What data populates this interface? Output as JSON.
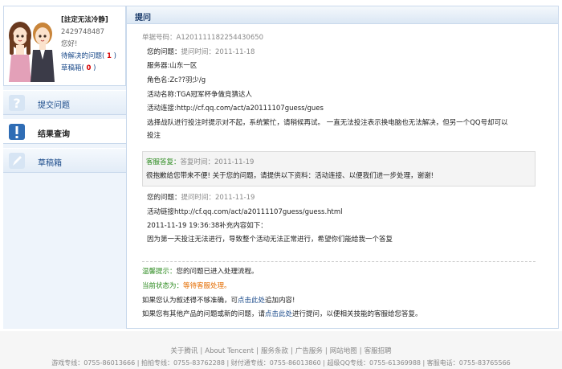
{
  "profile": {
    "username": "[註定无法冷静]",
    "qq": "2429748487",
    "greeting": "您好!",
    "pending_label": "待解决的问题(",
    "pending_count": "1",
    "drafts_label": "草稿箱(",
    "drafts_count": "0",
    "close_paren": ")"
  },
  "nav": [
    {
      "label": "提交问题"
    },
    {
      "label": "结果查询"
    },
    {
      "label": "草稿箱"
    }
  ],
  "panel": {
    "title": "提问",
    "ticket": "单据号码：A120111118225443065​0"
  },
  "question1": {
    "title": "您的问题：",
    "time": "提问时间：2011-11-18",
    "server": "服务器:山东一区",
    "role": "角色名:Zc??羽少/g",
    "activity": "活动名称:TGA冠军杯争做竞猜达人",
    "link": "活动连接:http://cf.qq.com/act/a20111107guess/gues",
    "desc1": "选择战队进行投注时提示对不起，系统繁忙，请稍候再试。  一直无法投注表示换电脑也无法解决，但另一个QQ号却可以",
    "desc2": "投注"
  },
  "reply": {
    "label": "客服答复：",
    "time": "答复时间：2011-11-19",
    "text": "很抱歉给您带来不便! 关于您的问题，请提供以下资料：活动连接、以便我们进一步处理，谢谢!"
  },
  "question2": {
    "title": "您的问题：",
    "time": "提问时间：2011-11-19",
    "link": "活动链接http://cf.qq.com/act/a20111107guess/guess.html",
    "supplement": "2011-11-19 19:36:38补充内容如下：",
    "desc": "因为第一天投注无法进行，导致整个活动无法正常进行，希望你们能给我一个答复"
  },
  "status": {
    "tip_label": "温馨提示：",
    "tip_text": "您的问题已进入处理流程。",
    "state_label": "当前状态为：",
    "state_value": "等待客服处理。",
    "line3_pre": "如果您认为叙述得不够准确，可",
    "line3_link": "点击此处",
    "line3_post": "追加内容!",
    "line4_pre": "如果您有其他产品的问题或新的问题，请",
    "line4_link": "点击此处",
    "line4_post": "进行提问，以便相关技能的客服给您答复。"
  },
  "footer": {
    "links": [
      "关于腾讯",
      "About Tencent",
      "服务条款",
      "广告服务",
      "网站地图",
      "客服招聘"
    ],
    "separator": "|",
    "phones": "游戏专线：0755-86013666 | 拍拍专线：0755-83762288 | 财付通专线：0755-86013860 | 超级QQ专线：0755-61369988 | 客服电话：0755-83765566"
  },
  "colors": {
    "nav_text": "#1a4a8a",
    "accent_green": "#2b8a1e",
    "accent_orange": "#e46c00",
    "count_red": "#d60000"
  }
}
